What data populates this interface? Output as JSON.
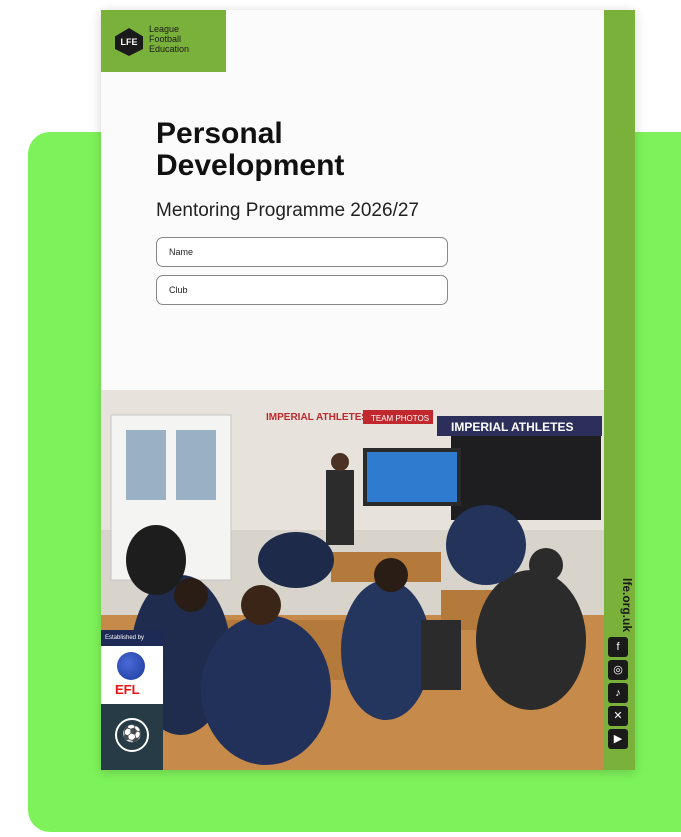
{
  "logo": {
    "badge": "LFE",
    "line1": "League",
    "line2": "Football",
    "line3": "Education"
  },
  "cover": {
    "title_line1": "Personal",
    "title_line2": "Development",
    "subtitle": "Mentoring Programme 2026/27",
    "field_name": "Name",
    "field_club": "Club"
  },
  "photo_signs": {
    "sign1": "IMPERIAL ATHLETES",
    "sign2": "TEAM PHOTOS",
    "sign3": "IMPERIAL ATHLETES"
  },
  "partners": {
    "established": "Established by",
    "efl": "EFL",
    "pfa_icon": "soccer-ball-icon"
  },
  "side": {
    "url": "lfe.org.uk",
    "social": [
      "facebook-icon",
      "instagram-icon",
      "tiktok-icon",
      "x-icon",
      "youtube-icon"
    ]
  },
  "colors": {
    "panel_green": "#7ef25a",
    "brand_green": "#7ab13b"
  }
}
